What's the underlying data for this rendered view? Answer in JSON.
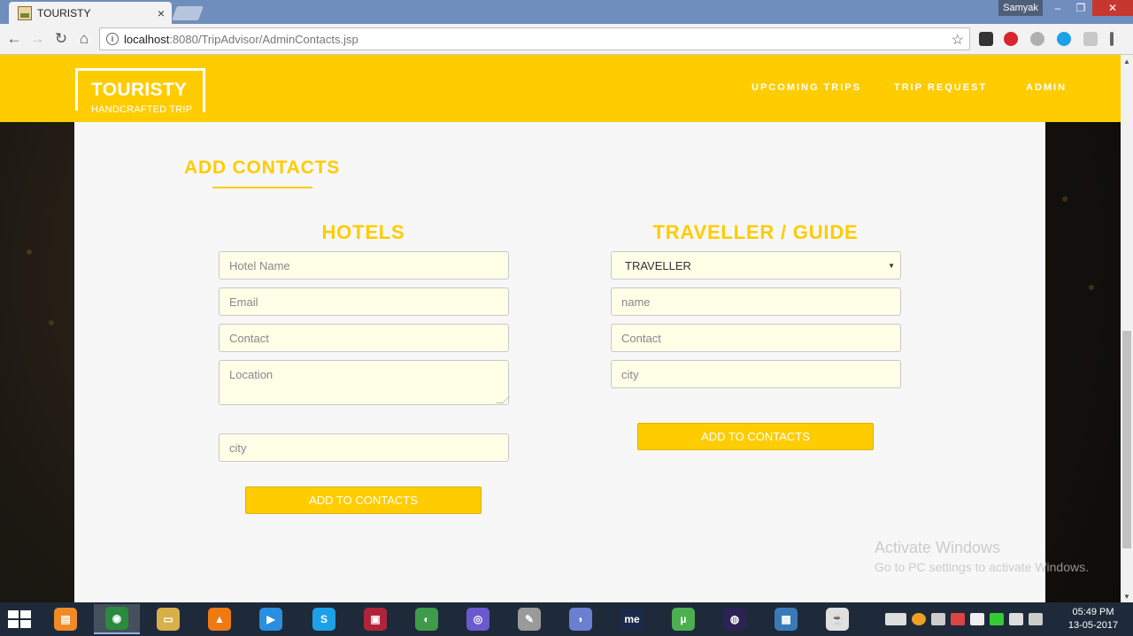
{
  "browser": {
    "tab_title": "TOURISTY",
    "tab_close": "×",
    "profile_name": "Samyak",
    "url_host": "localhost",
    "url_rest": ":8080/TripAdvisor/AdminContacts.jsp",
    "nav": {
      "back": "←",
      "forward": "→",
      "reload": "↻",
      "home": "⌂",
      "bookmark": "☆"
    },
    "window_controls": {
      "minimize": "–",
      "maximize": "❐",
      "close": "✕"
    }
  },
  "site": {
    "logo_title": "TOURISTY",
    "logo_subtitle": "HANDCRAFTED TRIP",
    "nav_links": [
      "UPCOMING TRIPS",
      "TRIP REQUEST",
      "ADMIN"
    ],
    "accent_color": "#ffcc00"
  },
  "page": {
    "section_title": "ADD CONTACTS",
    "hotels": {
      "heading": "HOTELS",
      "hotel_name_placeholder": "Hotel Name",
      "email_placeholder": "Email",
      "contact_placeholder": "Contact",
      "location_placeholder": "Location",
      "city_placeholder": "city",
      "submit_label": "ADD TO CONTACTS"
    },
    "traveller": {
      "heading": "TRAVELLER / GUIDE",
      "type_selected": "TRAVELLER",
      "select_arrow": "▼",
      "name_placeholder": "name",
      "contact_placeholder": "Contact",
      "city_placeholder": "city",
      "submit_label": "ADD TO CONTACTS"
    }
  },
  "watermark": {
    "title": "Activate Windows",
    "subtitle": "Go to PC settings to activate Windows."
  },
  "taskbar": {
    "time": "05:49 PM",
    "date": "13-05-2017",
    "apps": [
      {
        "name": "file-manager",
        "glyph": "▤",
        "color": "#f08a24"
      },
      {
        "name": "chrome",
        "glyph": "◉",
        "color": "#2b8a3e"
      },
      {
        "name": "file-explorer",
        "glyph": "▭",
        "color": "#d8b04a"
      },
      {
        "name": "vlc",
        "glyph": "▲",
        "color": "#f07a12"
      },
      {
        "name": "media-player",
        "glyph": "▶",
        "color": "#2a8fe0"
      },
      {
        "name": "skype",
        "glyph": "S",
        "color": "#1ea0e8"
      },
      {
        "name": "screen-recorder",
        "glyph": "▣",
        "color": "#b0243a"
      },
      {
        "name": "network-app",
        "glyph": "◐",
        "color": "#3f9a4a"
      },
      {
        "name": "torrent-app",
        "glyph": "◎",
        "color": "#6a5acd"
      },
      {
        "name": "notepad",
        "glyph": "✎",
        "color": "#9a9a9a"
      },
      {
        "name": "dolphin-app",
        "glyph": "◗",
        "color": "#6a7fd0"
      },
      {
        "name": "mediaencoder",
        "glyph": "me",
        "color": "#1b2a4a"
      },
      {
        "name": "utorrent",
        "glyph": "µ",
        "color": "#4caf50"
      },
      {
        "name": "eclipse",
        "glyph": "◍",
        "color": "#2c2255"
      },
      {
        "name": "photos",
        "glyph": "▦",
        "color": "#3a7ab8"
      },
      {
        "name": "java",
        "glyph": "☕",
        "color": "#e0e0e0"
      }
    ]
  }
}
